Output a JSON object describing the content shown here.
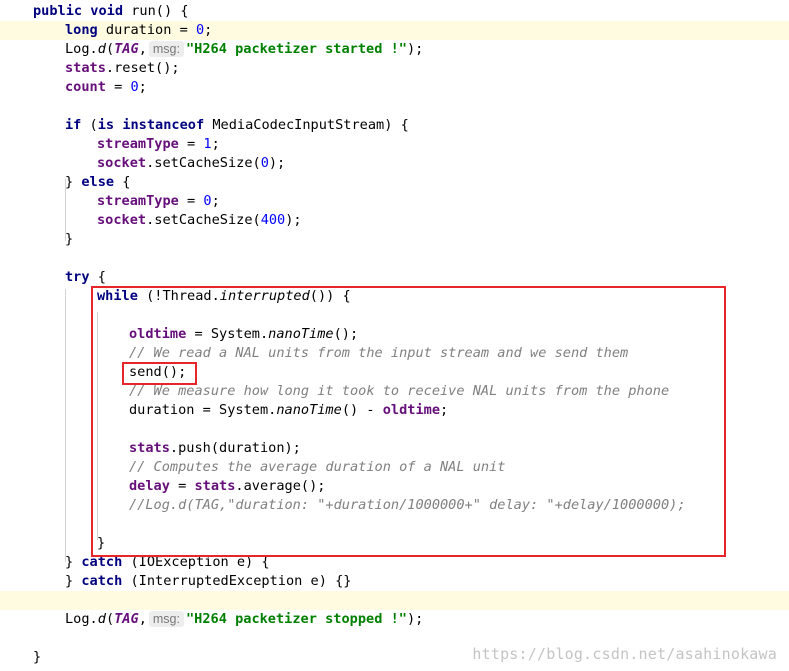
{
  "editor": {
    "highlighted_lines": [
      2,
      32
    ],
    "lines": [
      {
        "n": 1,
        "indent": 0,
        "tokens": [
          [
            "kw",
            "public"
          ],
          [
            "t",
            " "
          ],
          [
            "kw",
            "void"
          ],
          [
            "t",
            " run() {"
          ]
        ]
      },
      {
        "n": 2,
        "indent": 1,
        "tokens": [
          [
            "kw",
            "long"
          ],
          [
            "t",
            " duration = "
          ],
          [
            "num",
            "0"
          ],
          [
            "t",
            ";"
          ]
        ]
      },
      {
        "n": 3,
        "indent": 1,
        "tokens": [
          [
            "t",
            "Log."
          ],
          [
            "ital",
            "d"
          ],
          [
            "t",
            "("
          ],
          [
            "const",
            "TAG"
          ],
          [
            "t",
            ","
          ],
          [
            "hint",
            "msg:"
          ],
          [
            "str",
            "\"H264 packetizer started !\""
          ],
          [
            "t",
            ");"
          ]
        ]
      },
      {
        "n": 4,
        "indent": 1,
        "tokens": [
          [
            "fld",
            "stats"
          ],
          [
            "t",
            ".reset();"
          ]
        ]
      },
      {
        "n": 5,
        "indent": 1,
        "tokens": [
          [
            "fld",
            "count"
          ],
          [
            "t",
            " = "
          ],
          [
            "num",
            "0"
          ],
          [
            "t",
            ";"
          ]
        ]
      },
      {
        "n": 6,
        "indent": 0,
        "tokens": []
      },
      {
        "n": 7,
        "indent": 1,
        "tokens": [
          [
            "kw",
            "if"
          ],
          [
            "t",
            " ("
          ],
          [
            "kw",
            "is"
          ],
          [
            "t",
            " "
          ],
          [
            "kw",
            "instanceof"
          ],
          [
            "t",
            " MediaCodecInputStream) {"
          ]
        ]
      },
      {
        "n": 8,
        "indent": 2,
        "tokens": [
          [
            "fld",
            "streamType"
          ],
          [
            "t",
            " = "
          ],
          [
            "num",
            "1"
          ],
          [
            "t",
            ";"
          ]
        ]
      },
      {
        "n": 9,
        "indent": 2,
        "tokens": [
          [
            "fld",
            "socket"
          ],
          [
            "t",
            ".setCacheSize("
          ],
          [
            "num",
            "0"
          ],
          [
            "t",
            ");"
          ]
        ]
      },
      {
        "n": 10,
        "indent": 1,
        "tokens": [
          [
            "t",
            "} "
          ],
          [
            "kw",
            "else"
          ],
          [
            "t",
            " {"
          ]
        ]
      },
      {
        "n": 11,
        "indent": 2,
        "tokens": [
          [
            "fld",
            "streamType"
          ],
          [
            "t",
            " = "
          ],
          [
            "num",
            "0"
          ],
          [
            "t",
            ";"
          ]
        ]
      },
      {
        "n": 12,
        "indent": 2,
        "tokens": [
          [
            "fld",
            "socket"
          ],
          [
            "t",
            ".setCacheSize("
          ],
          [
            "num",
            "400"
          ],
          [
            "t",
            ");"
          ]
        ]
      },
      {
        "n": 13,
        "indent": 1,
        "tokens": [
          [
            "t",
            "}"
          ]
        ]
      },
      {
        "n": 14,
        "indent": 0,
        "tokens": []
      },
      {
        "n": 15,
        "indent": 1,
        "tokens": [
          [
            "kw",
            "try"
          ],
          [
            "t",
            " {"
          ]
        ]
      },
      {
        "n": 16,
        "indent": 2,
        "tokens": [
          [
            "kw",
            "while"
          ],
          [
            "t",
            " (!Thread."
          ],
          [
            "ital",
            "interrupted"
          ],
          [
            "t",
            "()) {"
          ]
        ]
      },
      {
        "n": 17,
        "indent": 0,
        "tokens": []
      },
      {
        "n": 18,
        "indent": 3,
        "tokens": [
          [
            "fld",
            "oldtime"
          ],
          [
            "t",
            " = System."
          ],
          [
            "ital",
            "nanoTime"
          ],
          [
            "t",
            "();"
          ]
        ]
      },
      {
        "n": 19,
        "indent": 3,
        "tokens": [
          [
            "cmt",
            "// We read a NAL units from the input stream and we send them"
          ]
        ]
      },
      {
        "n": 20,
        "indent": 3,
        "tokens": [
          [
            "t",
            "send();"
          ]
        ]
      },
      {
        "n": 21,
        "indent": 3,
        "tokens": [
          [
            "cmt",
            "// We measure how long it took to receive NAL units from the phone"
          ]
        ]
      },
      {
        "n": 22,
        "indent": 3,
        "tokens": [
          [
            "t",
            "duration = System."
          ],
          [
            "ital",
            "nanoTime"
          ],
          [
            "t",
            "() - "
          ],
          [
            "fld",
            "oldtime"
          ],
          [
            "t",
            ";"
          ]
        ]
      },
      {
        "n": 23,
        "indent": 0,
        "tokens": []
      },
      {
        "n": 24,
        "indent": 3,
        "tokens": [
          [
            "fld",
            "stats"
          ],
          [
            "t",
            ".push(duration);"
          ]
        ]
      },
      {
        "n": 25,
        "indent": 3,
        "tokens": [
          [
            "cmt",
            "// Computes the average duration of a NAL unit"
          ]
        ]
      },
      {
        "n": 26,
        "indent": 3,
        "tokens": [
          [
            "fld",
            "delay"
          ],
          [
            "t",
            " = "
          ],
          [
            "fld",
            "stats"
          ],
          [
            "t",
            ".average();"
          ]
        ]
      },
      {
        "n": 27,
        "indent": 3,
        "tokens": [
          [
            "cmt",
            "//Log.d(TAG,\"duration: \"+duration/1000000+\" delay: \"+delay/1000000);"
          ]
        ]
      },
      {
        "n": 28,
        "indent": 0,
        "tokens": []
      },
      {
        "n": 29,
        "indent": 2,
        "tokens": [
          [
            "t",
            "}"
          ]
        ]
      },
      {
        "n": 30,
        "indent": 1,
        "tokens": [
          [
            "t",
            "} "
          ],
          [
            "kw",
            "catch"
          ],
          [
            "t",
            " (IOException e) {"
          ]
        ]
      },
      {
        "n": 31,
        "indent": 1,
        "tokens": [
          [
            "t",
            "} "
          ],
          [
            "kw",
            "catch"
          ],
          [
            "t",
            " (InterruptedException e) {}"
          ]
        ]
      },
      {
        "n": 32,
        "indent": 0,
        "tokens": []
      },
      {
        "n": 33,
        "indent": 1,
        "tokens": [
          [
            "t",
            "Log."
          ],
          [
            "ital",
            "d"
          ],
          [
            "t",
            "("
          ],
          [
            "const",
            "TAG"
          ],
          [
            "t",
            ","
          ],
          [
            "hint",
            "msg:"
          ],
          [
            "str",
            "\"H264 packetizer stopped !\""
          ],
          [
            "t",
            ");"
          ]
        ]
      },
      {
        "n": 34,
        "indent": 0,
        "tokens": []
      },
      {
        "n": 35,
        "indent": 0,
        "tokens": [
          [
            "t",
            "}"
          ]
        ]
      }
    ]
  },
  "watermark": "https://blog.csdn.net/asahinokawa",
  "colors": {
    "keyword": "#000080",
    "number": "#0000ff",
    "string": "#008000",
    "field": "#660e7a",
    "comment": "#808080",
    "highlight_line": "#fffbe0",
    "annotation_box": "#e8252a",
    "watermark": "#c4c4c4"
  }
}
